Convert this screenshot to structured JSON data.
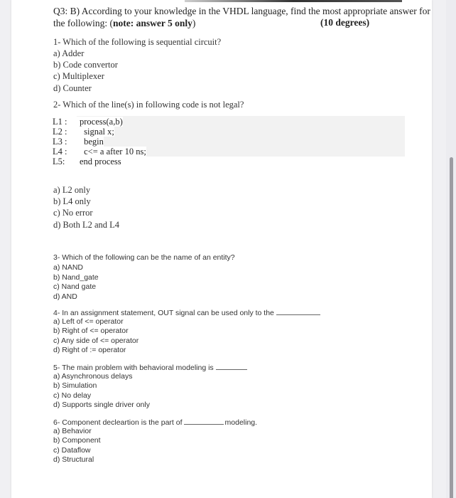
{
  "header": {
    "title_line1": "Q3: B)  According to your knowledge in the VHDL language, find the most appropriate answer for",
    "title_line2_prefix": "the following: (",
    "title_note": "note: answer 5 only",
    "title_line2_suffix": ")",
    "degrees": "(10 degrees)"
  },
  "questions": [
    {
      "text": "1-  Which of the following is sequential circuit?",
      "options": [
        "a) Adder",
        "b) Code convertor",
        "c) Multiplexer",
        "d) Counter"
      ]
    },
    {
      "text": "2- Which of the line(s) in following code is not legal?",
      "code": [
        {
          "label": "L1 :",
          "code": "process(a,b)"
        },
        {
          "label": "L2 :",
          "code": " signal x;"
        },
        {
          "label": "L3 :",
          "code": " begin"
        },
        {
          "label": "L4 :",
          "code": " c<= a after 10 ns;"
        },
        {
          "label": "L5:",
          "code": "end process"
        }
      ],
      "options": [
        "a) L2 only",
        "b) L4 only",
        "c) No error",
        "d) Both L2 and L4"
      ]
    },
    {
      "text": "3- Which of the following can be the name of an entity?",
      "options": [
        "a) NAND",
        "b) Nand_gate",
        "c) Nand gate",
        "d) AND"
      ]
    },
    {
      "text": "4- In an assignment statement, OUT signal can be used only to the",
      "options": [
        "a) Left of <= operator",
        "b) Right of <= operator",
        "c) Any side of <= operator",
        "d) Right of := operator"
      ]
    },
    {
      "text": "5- The main problem with behavioral modeling is",
      "options": [
        "a) Asynchronous delays",
        "b) Simulation",
        "c) No delay",
        "d) Supports single driver only"
      ]
    },
    {
      "text_before": "6- Component decleartion is the part of",
      "text_after": "modeling.",
      "options": [
        "a) Behavior",
        "b) Component",
        "c) Dataflow",
        "d) Structural"
      ]
    }
  ]
}
